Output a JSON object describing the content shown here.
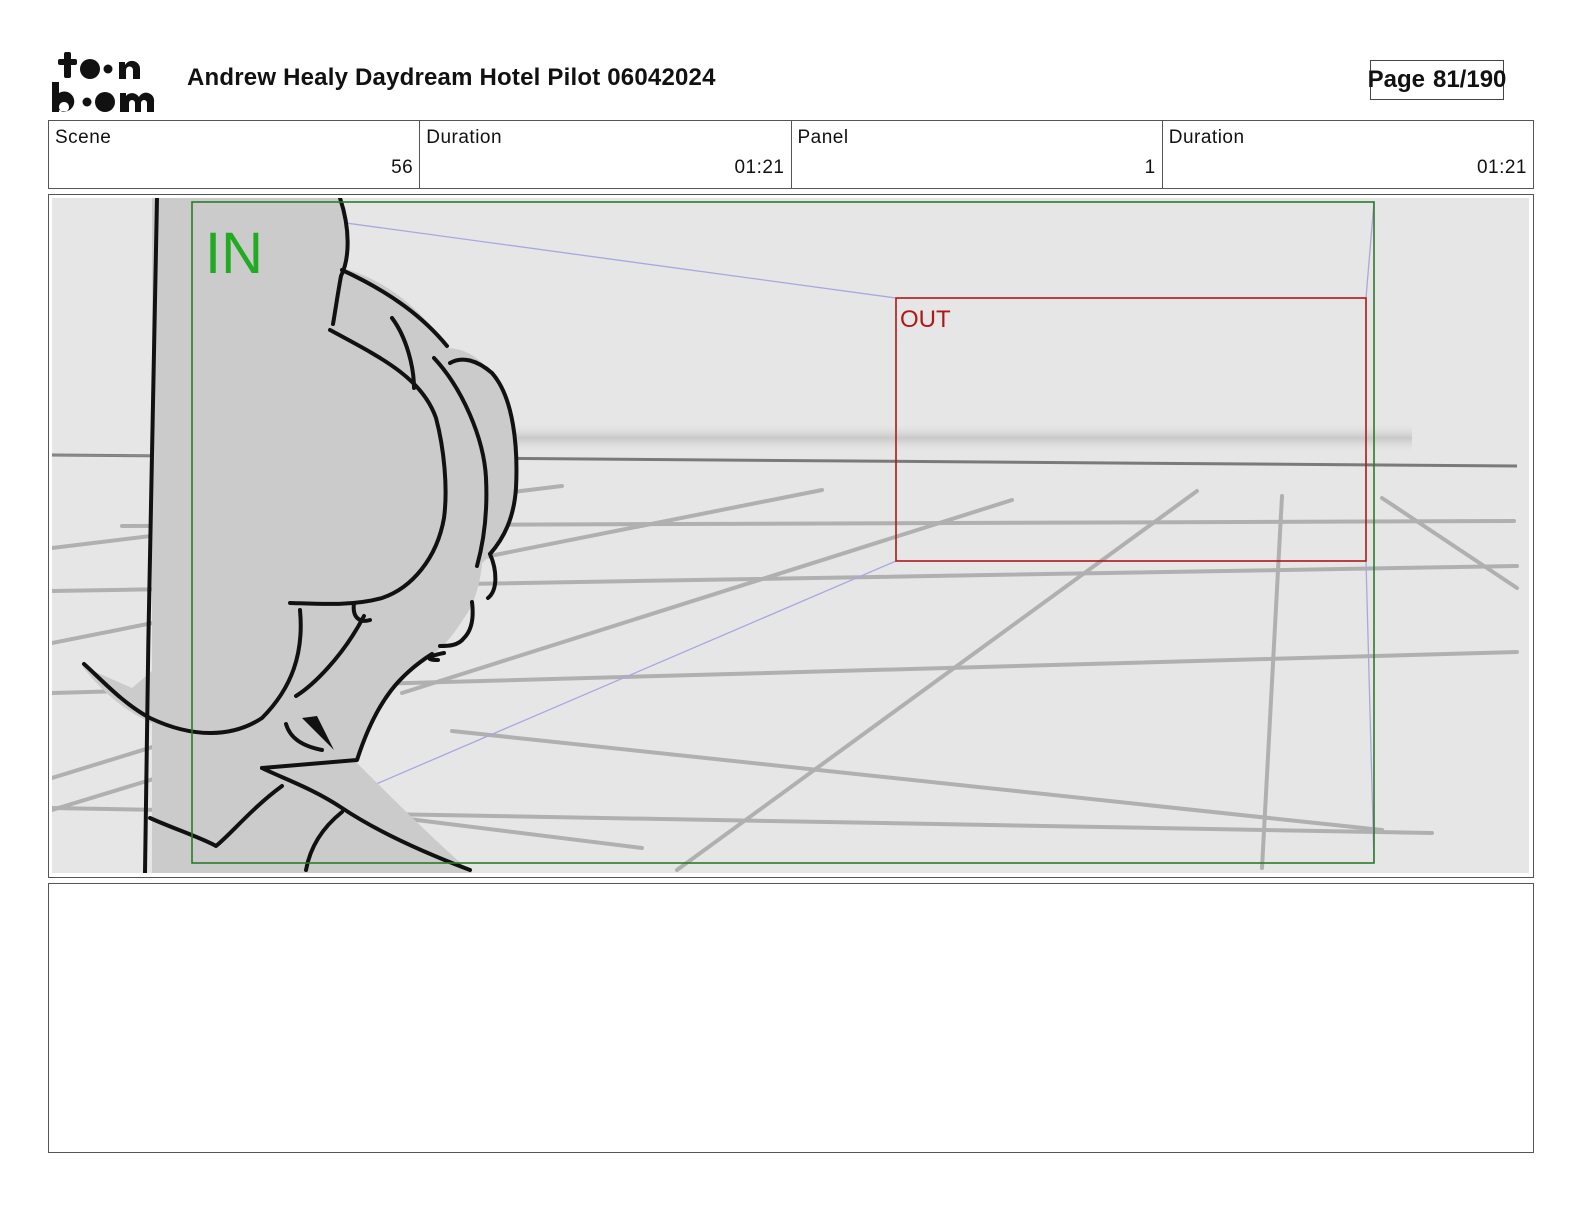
{
  "header": {
    "logo_text": "toon boom",
    "title": "Andrew Healy Daydream Hotel Pilot 06042024",
    "page_label": "Page",
    "page_number": "81/190"
  },
  "info": [
    {
      "label": "Scene",
      "value": "56"
    },
    {
      "label": "Duration",
      "value": "01:21"
    },
    {
      "label": "Panel",
      "value": "1"
    },
    {
      "label": "Duration",
      "value": "01:21"
    }
  ],
  "panel": {
    "in_label": "IN",
    "out_label": "OUT",
    "colors": {
      "in_frame": "#2a7a2a",
      "in_text": "#22aa22",
      "out_frame": "#b01818",
      "guide_lines": "#a8a8e0",
      "background": "#e6e6e6"
    }
  },
  "notes": {
    "text": ""
  }
}
